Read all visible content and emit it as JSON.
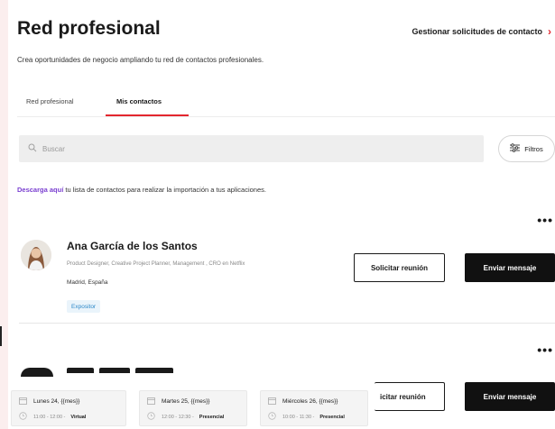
{
  "header": {
    "title": "Red profesional",
    "manage_link": "Gestionar solicitudes de contacto",
    "subtitle": "Crea oportunidades de negocio ampliando tu red de contactos profesionales."
  },
  "tabs": [
    {
      "label": "Red profesional",
      "active": false
    },
    {
      "label": "Mis contactos",
      "active": true
    }
  ],
  "search": {
    "placeholder": "Buscar",
    "filters_label": "Filtros"
  },
  "download": {
    "link_text": "Descarga aquí",
    "rest_text": " tu lista de contactos para realizar la importación a tus aplicaciones."
  },
  "contacts": [
    {
      "name": "Ana García de los Santos",
      "role": "Product Designer, Creative Project Planner, Management , CRO en Netflix",
      "location": "Madrid, España",
      "badge": "Expositor",
      "request_label": "Solicitar reunión",
      "message_label": "Enviar mensaje"
    },
    {
      "name": "",
      "request_label": "icitar reunión",
      "message_label": "Enviar mensaje"
    }
  ],
  "meetings": [
    {
      "date": "Lunes 24, {{mes}}",
      "time": "11:00 - 12:00 -",
      "mode": "Virtual"
    },
    {
      "date": "Martes 25, {{mes}}",
      "time": "12:00 - 12:30 -",
      "mode": "Presencial"
    },
    {
      "date": "Miércoles 26, {{mes}}",
      "time": "10:00 - 11:30 -",
      "mode": "Presencial"
    }
  ],
  "colors": {
    "accent": "#e3262e",
    "link": "#7a3fd0",
    "badge": "#2d88c8"
  }
}
